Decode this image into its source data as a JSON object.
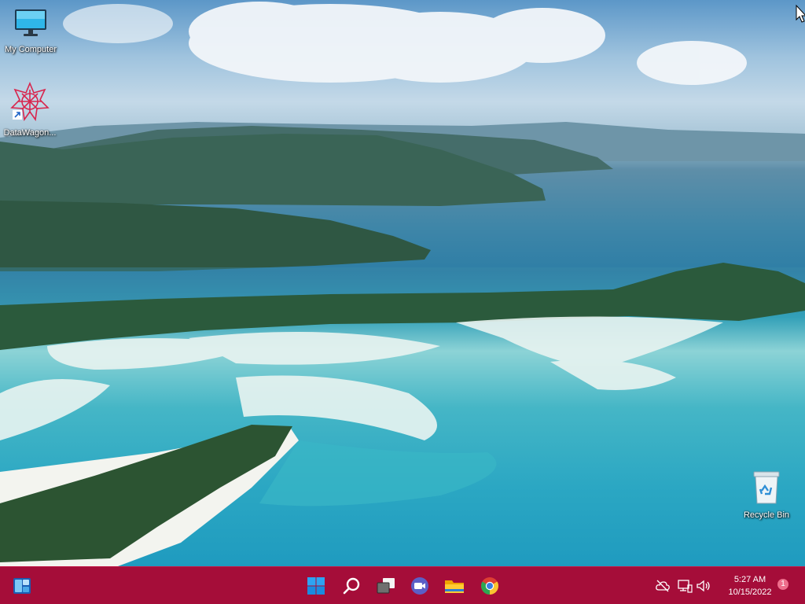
{
  "desktop": {
    "icons": [
      {
        "label": "My Computer",
        "icon": "monitor-icon"
      },
      {
        "label": "DataWagon...",
        "icon": "datawagon-shortcut-icon"
      },
      {
        "label": "Recycle Bin",
        "icon": "recycle-bin-icon"
      }
    ]
  },
  "taskbar": {
    "widgets_icon": "widgets-icon",
    "apps": [
      {
        "name": "Start",
        "icon": "windows-start-icon"
      },
      {
        "name": "Search",
        "icon": "search-icon"
      },
      {
        "name": "Task View",
        "icon": "task-view-icon"
      },
      {
        "name": "Chat",
        "icon": "chat-camera-icon"
      },
      {
        "name": "File Explorer",
        "icon": "folder-icon"
      },
      {
        "name": "Google Chrome",
        "icon": "chrome-icon"
      }
    ],
    "tray": {
      "icons": [
        "cloud-offline-icon",
        "network-icon",
        "volume-icon"
      ],
      "time": "5:27 AM",
      "date": "10/15/2022",
      "notification_count": "1"
    },
    "color": "#a50d39"
  }
}
